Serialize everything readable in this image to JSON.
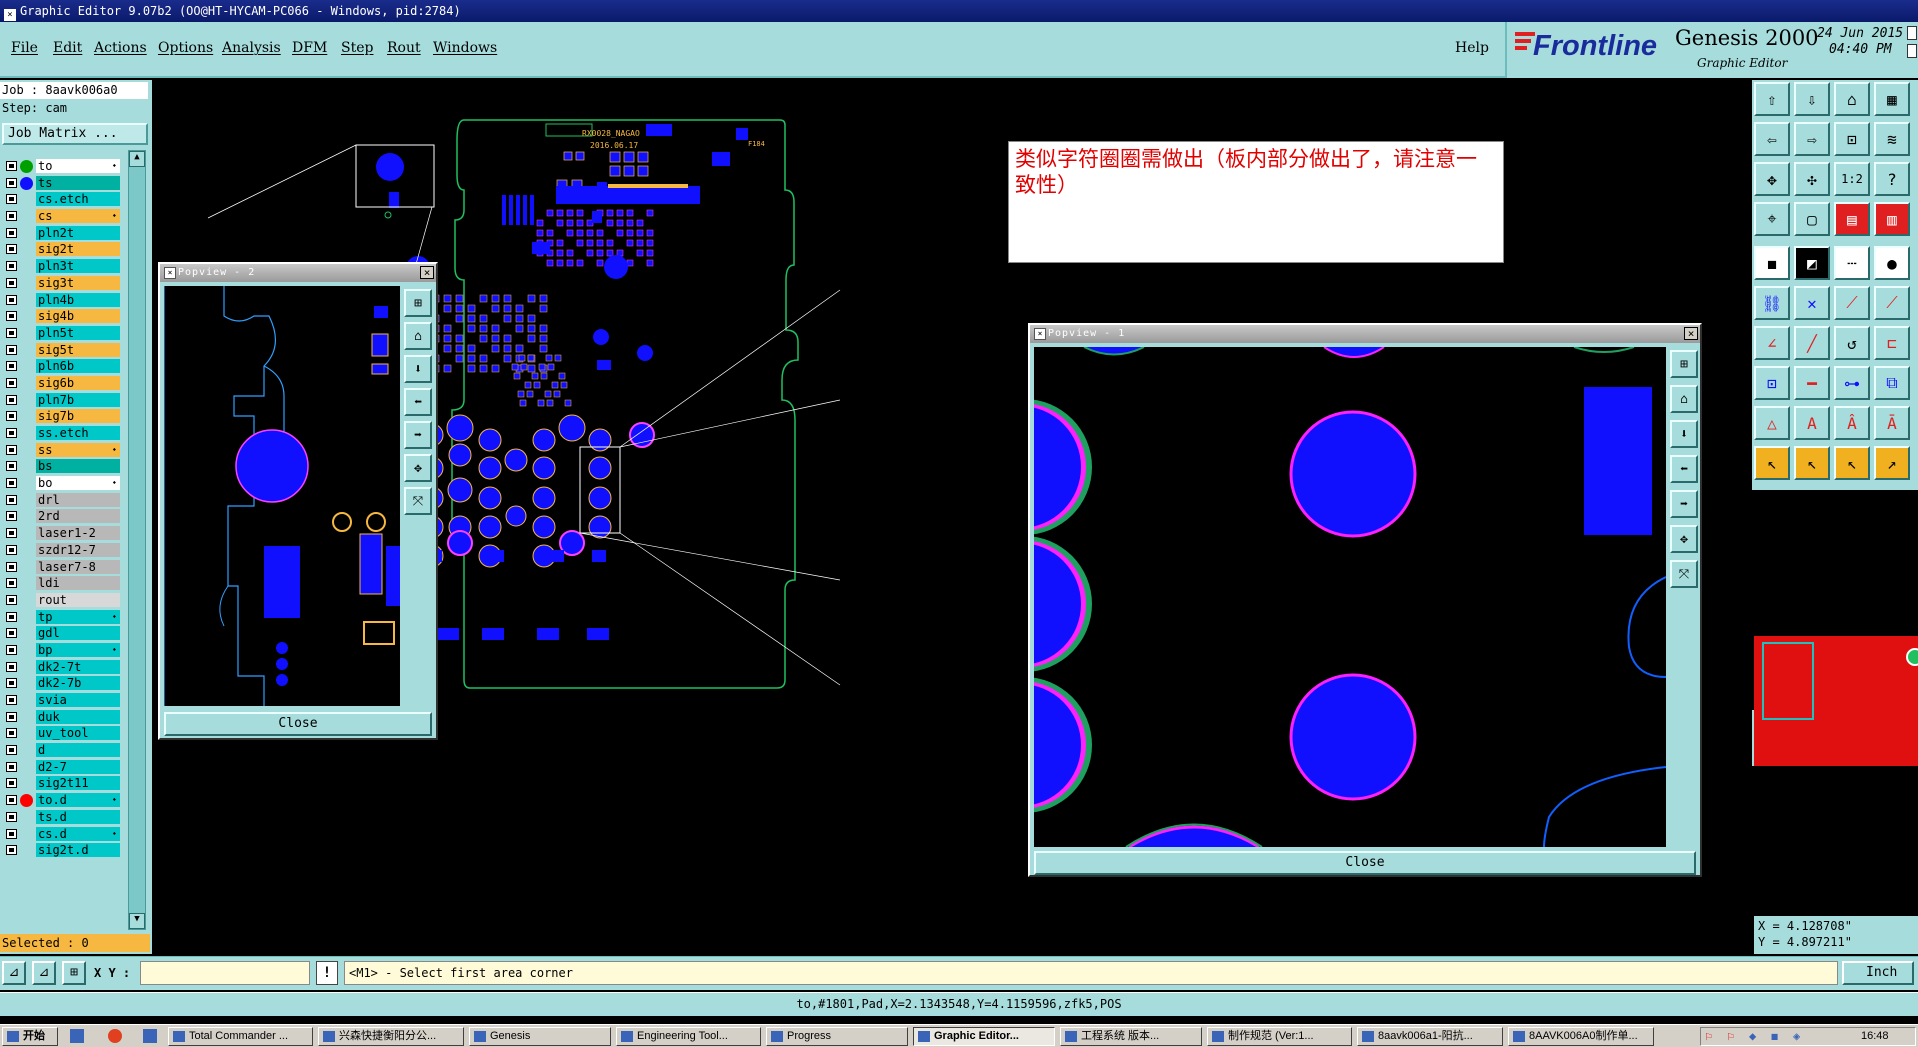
{
  "window": {
    "title": "Graphic Editor 9.07b2 (OO@HT-HYCAM-PC066 - Windows, pid:2784)"
  },
  "menu": [
    "File",
    "Edit",
    "Actions",
    "Options",
    "Analysis",
    "DFM",
    "Step",
    "Rout",
    "Windows"
  ],
  "help": "Help",
  "brand": {
    "logo": "Frontline",
    "product": "Genesis 2000",
    "subtitle": "Graphic Editor",
    "date": "24 Jun 2015",
    "time": "04:40 PM"
  },
  "job": "Job  : 8aavk006a0",
  "step": "Step: cam",
  "job_matrix": "Job Matrix ...",
  "layers": [
    {
      "name": "to",
      "color": "#ffffff",
      "dot": "#00a000",
      "star": true
    },
    {
      "name": "ts",
      "color": "#00b0a0",
      "dot": "#1010ff",
      "star": false
    },
    {
      "name": "cs.etch",
      "color": "#00c8c8",
      "dot": "",
      "star": false
    },
    {
      "name": "cs",
      "color": "#f6b840",
      "dot": "",
      "star": true
    },
    {
      "name": "pln2t",
      "color": "#00c8c8",
      "dot": "",
      "star": false
    },
    {
      "name": "sig2t",
      "color": "#f6b840",
      "dot": "",
      "star": false
    },
    {
      "name": "pln3t",
      "color": "#00c8c8",
      "dot": "",
      "star": false
    },
    {
      "name": "sig3t",
      "color": "#f6b840",
      "dot": "",
      "star": false
    },
    {
      "name": "pln4b",
      "color": "#00c8c8",
      "dot": "",
      "star": false
    },
    {
      "name": "sig4b",
      "color": "#f6b840",
      "dot": "",
      "star": false
    },
    {
      "name": "pln5t",
      "color": "#00c8c8",
      "dot": "",
      "star": false
    },
    {
      "name": "sig5t",
      "color": "#f6b840",
      "dot": "",
      "star": false
    },
    {
      "name": "pln6b",
      "color": "#00c8c8",
      "dot": "",
      "star": false
    },
    {
      "name": "sig6b",
      "color": "#f6b840",
      "dot": "",
      "star": false
    },
    {
      "name": "pln7b",
      "color": "#00c8c8",
      "dot": "",
      "star": false
    },
    {
      "name": "sig7b",
      "color": "#f6b840",
      "dot": "",
      "star": false
    },
    {
      "name": "ss.etch",
      "color": "#00c8c8",
      "dot": "",
      "star": false
    },
    {
      "name": "ss",
      "color": "#f6b840",
      "dot": "",
      "star": true
    },
    {
      "name": "bs",
      "color": "#00b0a0",
      "dot": "",
      "star": false
    },
    {
      "name": "bo",
      "color": "#ffffff",
      "dot": "",
      "star": true
    },
    {
      "name": "drl",
      "color": "#b8b8b8",
      "dot": "",
      "star": false
    },
    {
      "name": "2rd",
      "color": "#b8b8b8",
      "dot": "",
      "star": false
    },
    {
      "name": "laser1-2",
      "color": "#b8b8b8",
      "dot": "",
      "star": false
    },
    {
      "name": "szdr12-7",
      "color": "#b8b8b8",
      "dot": "",
      "star": false
    },
    {
      "name": "laser7-8",
      "color": "#b8b8b8",
      "dot": "",
      "star": false
    },
    {
      "name": "ldi",
      "color": "#b8b8b8",
      "dot": "",
      "star": false
    },
    {
      "name": "rout",
      "color": "#d8d8d8",
      "dot": "",
      "star": false
    },
    {
      "name": "tp",
      "color": "#00c8c8",
      "dot": "",
      "star": true
    },
    {
      "name": "gdl",
      "color": "#00c8c8",
      "dot": "",
      "star": false
    },
    {
      "name": "bp",
      "color": "#00c8c8",
      "dot": "",
      "star": true
    },
    {
      "name": "dk2-7t",
      "color": "#00c8c8",
      "dot": "",
      "star": false
    },
    {
      "name": "dk2-7b",
      "color": "#00c8c8",
      "dot": "",
      "star": false
    },
    {
      "name": "svia",
      "color": "#00c8c8",
      "dot": "",
      "star": false
    },
    {
      "name": "duk",
      "color": "#00c8c8",
      "dot": "",
      "star": false
    },
    {
      "name": "uv_tool",
      "color": "#00c8c8",
      "dot": "",
      "star": false
    },
    {
      "name": "d",
      "color": "#00c8c8",
      "dot": "",
      "star": false
    },
    {
      "name": "d2-7",
      "color": "#00c8c8",
      "dot": "",
      "star": false
    },
    {
      "name": "sig2t11",
      "color": "#00c8c8",
      "dot": "",
      "star": false
    },
    {
      "name": "to.d",
      "color": "#00c8c8",
      "dot": "#ff0000",
      "star": true
    },
    {
      "name": "ts.d",
      "color": "#00c8c8",
      "dot": "",
      "star": false
    },
    {
      "name": "cs.d",
      "color": "#00c8c8",
      "dot": "",
      "star": true
    },
    {
      "name": "sig2t.d",
      "color": "#00c8c8",
      "dot": "",
      "star": false
    }
  ],
  "selected": "Selected : 0",
  "xy_label": "X Y :",
  "xy_value": "",
  "prompt": "<M1> - Select first area corner",
  "units": "Inch",
  "status": "to,#1801,Pad,X=2.1343548,Y=4.1159596,zfk5,POS",
  "coords": {
    "x": "X = 4.128708\"",
    "y": "Y = 4.897211\""
  },
  "note": "类似字符圈圈需做出（板内部分做出了，请注意一致性）",
  "board": {
    "label1": "RX0028_NAGAO",
    "label2": "2016.06.17",
    "label3": "F184"
  },
  "popview1": {
    "title": "Popview - 1",
    "close": "Close"
  },
  "popview2": {
    "title": "Popview - 2",
    "close": "Close"
  },
  "taskbar": {
    "start": "开始",
    "items": [
      "Total Commander ...",
      "兴森快捷衡阳分公...",
      "Genesis",
      "Engineering Tool...",
      "Progress",
      "Graphic Editor...",
      "工程系统   版本...",
      "制作规范 (Ver:1...",
      "8aavk006a1-阳抗...",
      "8AAVK006A0制作单..."
    ],
    "clock": "16:48"
  },
  "colors": {
    "accent": "#a6dcdc",
    "layer_orange": "#f6b840",
    "pad_blue": "#1010ff",
    "pad_ring": "#ff20ff"
  }
}
